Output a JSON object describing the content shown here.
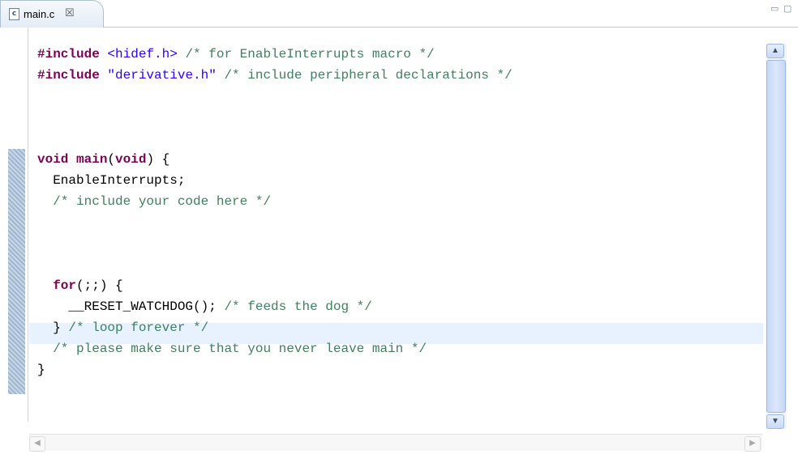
{
  "tab": {
    "label": "main.c",
    "close": "☒",
    "icon": "c-file-icon"
  },
  "window": {
    "minimize": "▭",
    "maximize": "▢"
  },
  "code_lines": [
    {
      "parts": [
        {
          "c": "pp",
          "t": "#include "
        },
        {
          "c": "str",
          "t": "<hidef.h>"
        },
        {
          "c": "cm",
          "t": " /* for EnableInterrupts macro */"
        }
      ]
    },
    {
      "parts": [
        {
          "c": "pp",
          "t": "#include "
        },
        {
          "c": "str",
          "t": "\"derivative.h\""
        },
        {
          "c": "cm",
          "t": " /* include peripheral declarations */"
        }
      ]
    },
    {
      "parts": []
    },
    {
      "parts": []
    },
    {
      "parts": []
    },
    {
      "parts": [
        {
          "c": "kw",
          "t": "void"
        },
        {
          "c": "",
          "t": " "
        },
        {
          "c": "kw",
          "t": "main"
        },
        {
          "c": "",
          "t": "("
        },
        {
          "c": "kw",
          "t": "void"
        },
        {
          "c": "",
          "t": ") {"
        }
      ]
    },
    {
      "parts": [
        {
          "c": "",
          "t": "  EnableInterrupts;"
        }
      ]
    },
    {
      "parts": [
        {
          "c": "cm",
          "t": "  /* include your code here */"
        }
      ]
    },
    {
      "parts": []
    },
    {
      "parts": []
    },
    {
      "parts": []
    },
    {
      "parts": [
        {
          "c": "kw",
          "t": "  for"
        },
        {
          "c": "",
          "t": "(;;) {"
        }
      ]
    },
    {
      "parts": [
        {
          "c": "",
          "t": "    __RESET_WATCHDOG();"
        },
        {
          "c": "cm",
          "t": " /* feeds the dog */"
        }
      ]
    },
    {
      "parts": [
        {
          "c": "",
          "t": "  } "
        },
        {
          "c": "cm",
          "t": "/* loop forever */"
        }
      ]
    },
    {
      "parts": [
        {
          "c": "cm",
          "t": "  /* please make sure that you never leave main */"
        }
      ]
    },
    {
      "parts": [
        {
          "c": "",
          "t": "}"
        }
      ]
    }
  ]
}
